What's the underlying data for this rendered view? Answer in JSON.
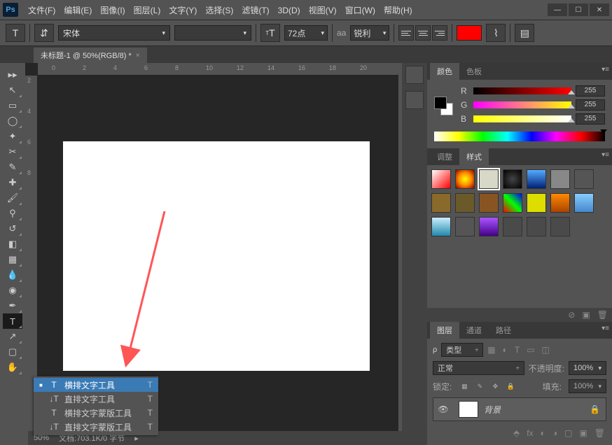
{
  "app": {
    "icon": "Ps"
  },
  "menus": [
    "文件(F)",
    "编辑(E)",
    "图像(I)",
    "图层(L)",
    "文字(Y)",
    "选择(S)",
    "滤镜(T)",
    "3D(D)",
    "视图(V)",
    "窗口(W)",
    "帮助(H)"
  ],
  "optbar": {
    "font": "宋体",
    "size": "72点",
    "aa_label": "aa",
    "sharp": "锐利",
    "size_icon": "T"
  },
  "doc_tab": {
    "title": "未标题-1 @ 50%(RGB/8) *"
  },
  "ruler_marks": [
    "0",
    "2",
    "4",
    "6",
    "8",
    "10",
    "12",
    "14",
    "16",
    "18",
    "20"
  ],
  "ruler_v": [
    "2",
    "4",
    "6",
    "8"
  ],
  "flyout": [
    {
      "icon": "T",
      "label": "横排文字工具",
      "sc": "T",
      "sel": true
    },
    {
      "icon": "↓T",
      "label": "直排文字工具",
      "sc": "T",
      "sel": false
    },
    {
      "icon": "T",
      "label": "横排文字蒙版工具",
      "sc": "T",
      "sel": false
    },
    {
      "icon": "↓T",
      "label": "直排文字蒙版工具",
      "sc": "T",
      "sel": false
    }
  ],
  "status": {
    "zoom": "50%",
    "info": "文档:703.1K/0 字节"
  },
  "color_panel": {
    "tab_color": "颜色",
    "tab_swatch": "色板",
    "channels": [
      {
        "label": "R",
        "value": "255",
        "grad": "linear-gradient(to right,#000,#f00)"
      },
      {
        "label": "G",
        "value": "255",
        "grad": "linear-gradient(to right,#f0f,#ff0)"
      },
      {
        "label": "B",
        "value": "255",
        "grad": "linear-gradient(to right,#ff0,#fff)"
      }
    ]
  },
  "styles_panel": {
    "tab_adjust": "调整",
    "tab_styles": "样式",
    "swatches": [
      "linear-gradient(135deg,#fff,#f00)",
      "radial-gradient(#ff0,#f80,#800)",
      "#d8d8c8",
      "radial-gradient(#444,#000)",
      "linear-gradient(#5af,#027)",
      "#888",
      "#555",
      "#8a6a2a",
      "#6a5a2a",
      "#885522",
      "linear-gradient(45deg,#f00,#0f0,#00f)",
      "#dd0",
      "linear-gradient(#f80,#a40)",
      "linear-gradient(#8cf,#48c)",
      "linear-gradient(#cef,#28a)",
      "#555",
      "linear-gradient(#a5f,#408)",
      "#4a4a4a",
      "#4a4a4a",
      "#4a4a4a"
    ]
  },
  "layers_panel": {
    "tab_layers": "图层",
    "tab_channels": "通道",
    "tab_paths": "路径",
    "kind_label": "类型",
    "blend": "正常",
    "opacity_label": "不透明度:",
    "opacity": "100%",
    "lock_label": "锁定:",
    "fill_label": "填充:",
    "fill": "100%",
    "layer_name": "背景"
  }
}
